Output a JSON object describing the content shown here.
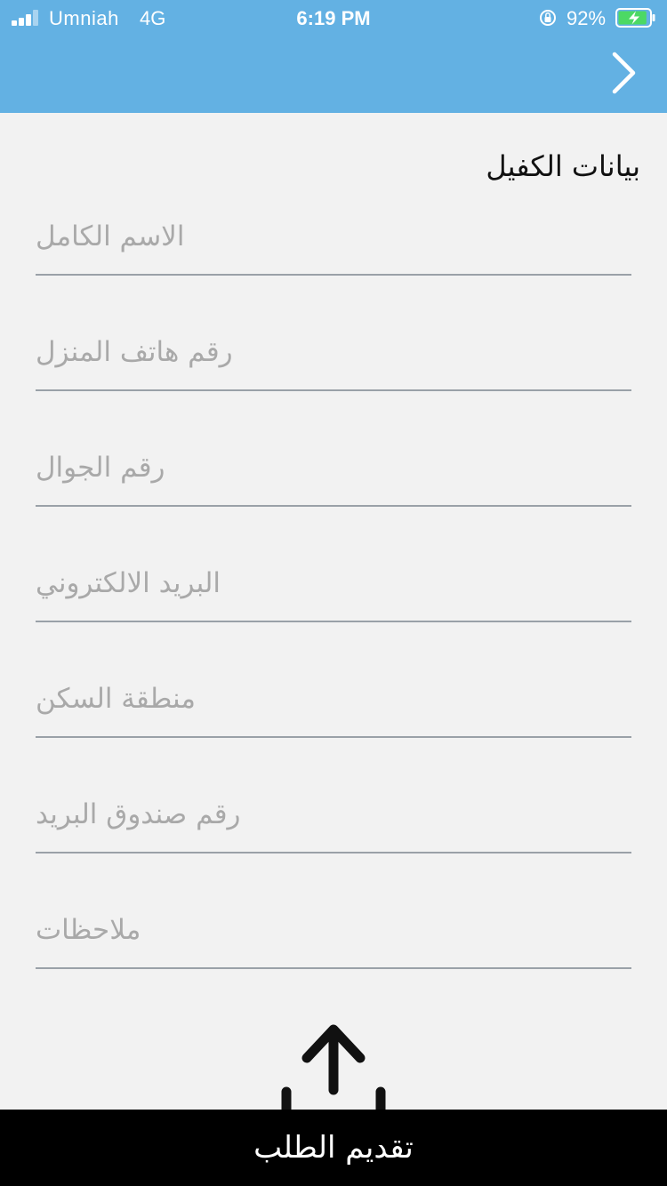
{
  "status_bar": {
    "carrier": "Umniah",
    "network": "4G",
    "time": "6:19 PM",
    "battery_percent": "92%",
    "battery_level": 0.92,
    "icons": [
      "signal-icon",
      "orientation-lock-icon",
      "battery-charging-icon"
    ]
  },
  "header": {
    "background_color": "#63b1e3",
    "back_icon": "chevron-right-icon"
  },
  "form": {
    "title": "بيانات الكفيل",
    "fields": [
      {
        "placeholder": "الاسم الكامل",
        "value": ""
      },
      {
        "placeholder": "رقم هاتف المنزل",
        "value": ""
      },
      {
        "placeholder": "رقم الجوال",
        "value": ""
      },
      {
        "placeholder": "البريد الالكتروني",
        "value": ""
      },
      {
        "placeholder": "منطقة السكن",
        "value": ""
      },
      {
        "placeholder": "رقم صندوق البريد",
        "value": ""
      },
      {
        "placeholder": "ملاحظات",
        "value": ""
      }
    ]
  },
  "submit": {
    "label": "تقديم الطلب",
    "icon": "upload-icon"
  }
}
